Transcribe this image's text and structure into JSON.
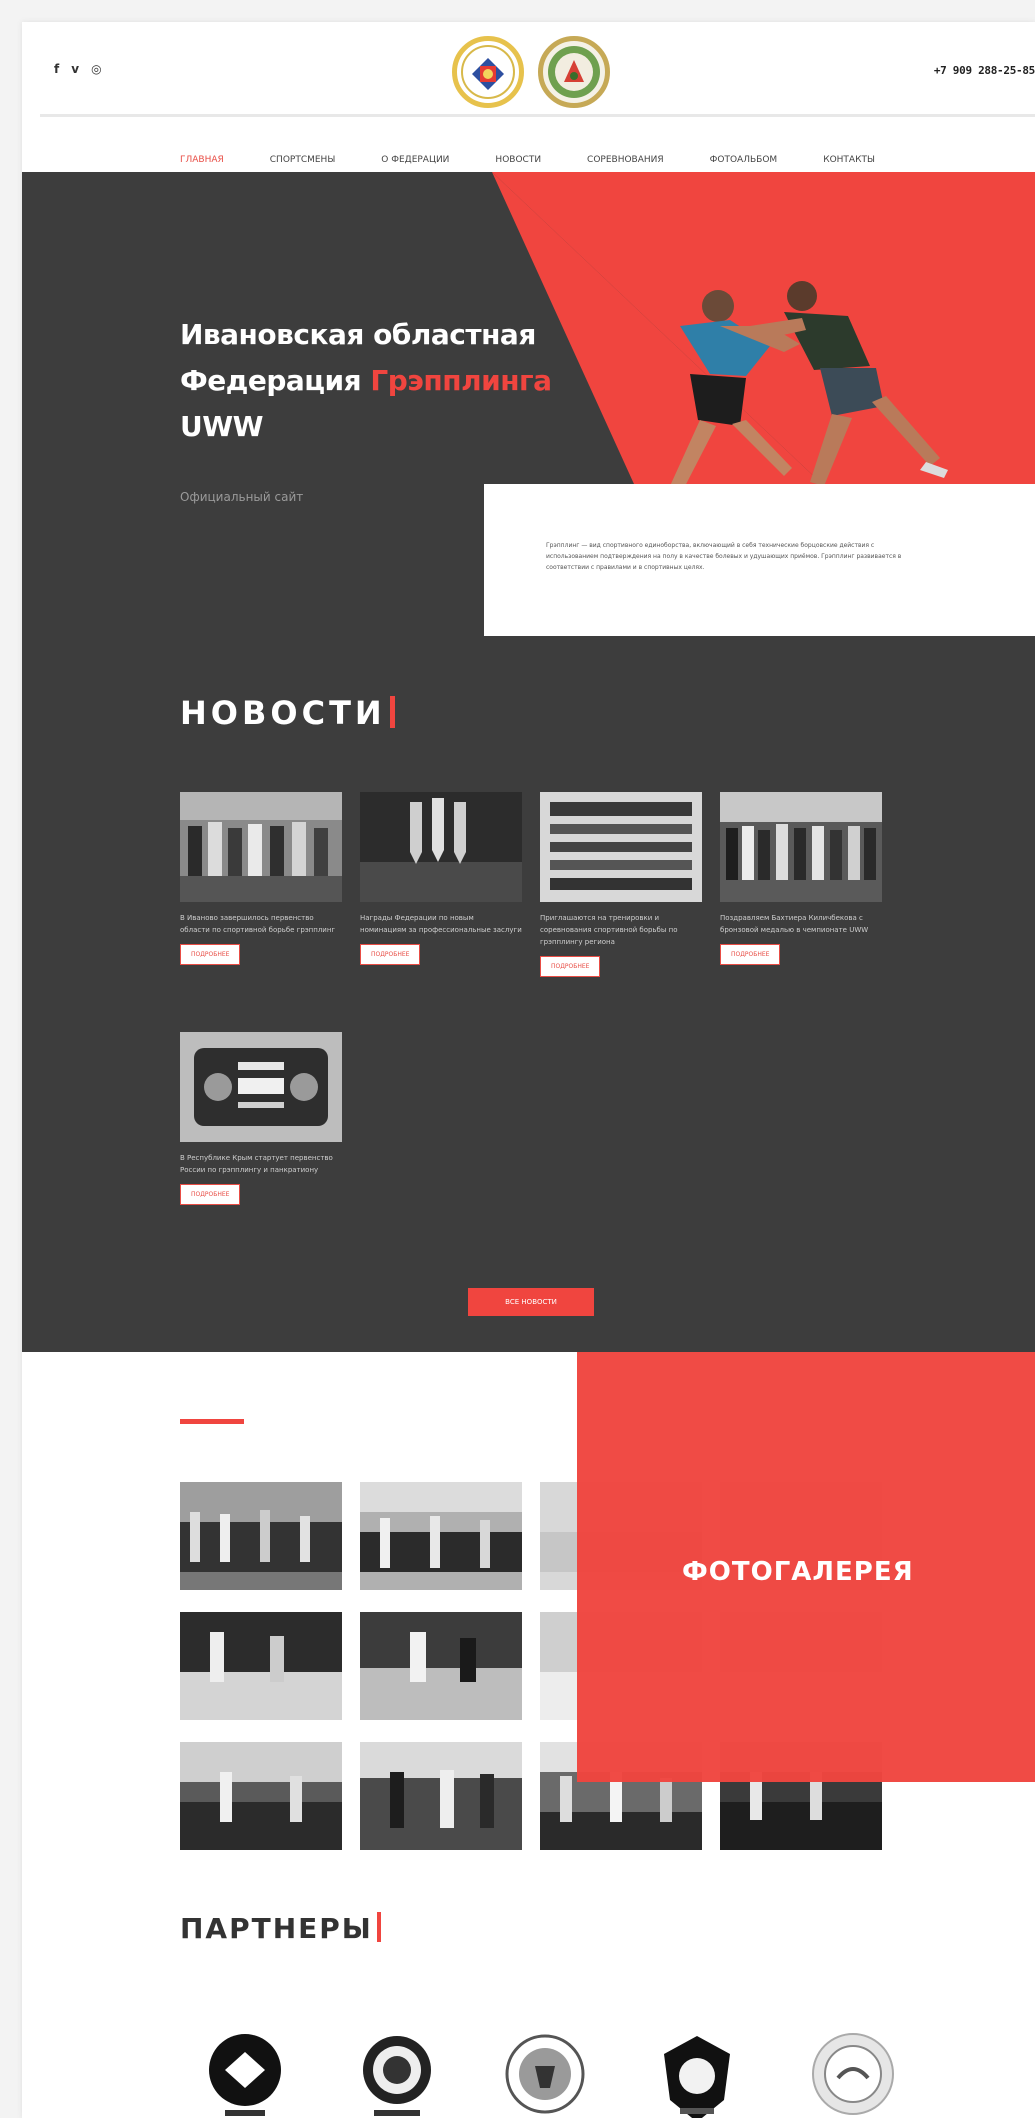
{
  "header": {
    "social": [
      "f",
      "v",
      "◎"
    ],
    "phone": "+7 909 288-25-85",
    "nav": [
      "ГЛАВНАЯ",
      "СПОРТСМЕНЫ",
      "О ФЕДЕРАЦИИ",
      "НОВОСТИ",
      "СОРЕВНОВАНИЯ",
      "ФОТОАЛЬБОМ",
      "КОНТАКТЫ"
    ]
  },
  "hero": {
    "title_line1": "Ивановская областная",
    "title_line2a": "Федерация ",
    "title_line2b": "Грэпплинга",
    "title_line3": "UWW",
    "subtitle": "Официальный сайт",
    "about": "Грэпплинг — вид спортивного единоборства, включающий в себя технические борцовские действия с использованием подтверждения на полу в качестве болевых и удушающих приёмов. Грэпплинг развивается в соответствии с правилами и в спортивных целях."
  },
  "news": {
    "heading": "НОВОСТИ",
    "more_label": "ПОДРОБНЕЕ",
    "all_label": "ВСЕ НОВОСТИ",
    "items": [
      {
        "text": "В Иваново завершилось первенство области по спортивной борьбе грэпплинг"
      },
      {
        "text": "Награды Федерации по новым номинациям за профессиональные заслуги"
      },
      {
        "text": "Приглашаются на тренировки и соревнования спортивной борьбы по грэпплингу региона"
      },
      {
        "text": "Поздравляем Бахтиера Киличбекова с бронзовой медалью в чемпионате UWW"
      },
      {
        "text": "В Республике Крым стартует первенство России по грэпплингу и панкратиону"
      }
    ]
  },
  "gallery": {
    "heading": "ФОТОГАЛЕРЕЯ"
  },
  "partners": {
    "heading": "ПАРТНЕРЫ"
  },
  "colors": {
    "accent": "#f0453f",
    "dark": "#3d3d3d"
  }
}
